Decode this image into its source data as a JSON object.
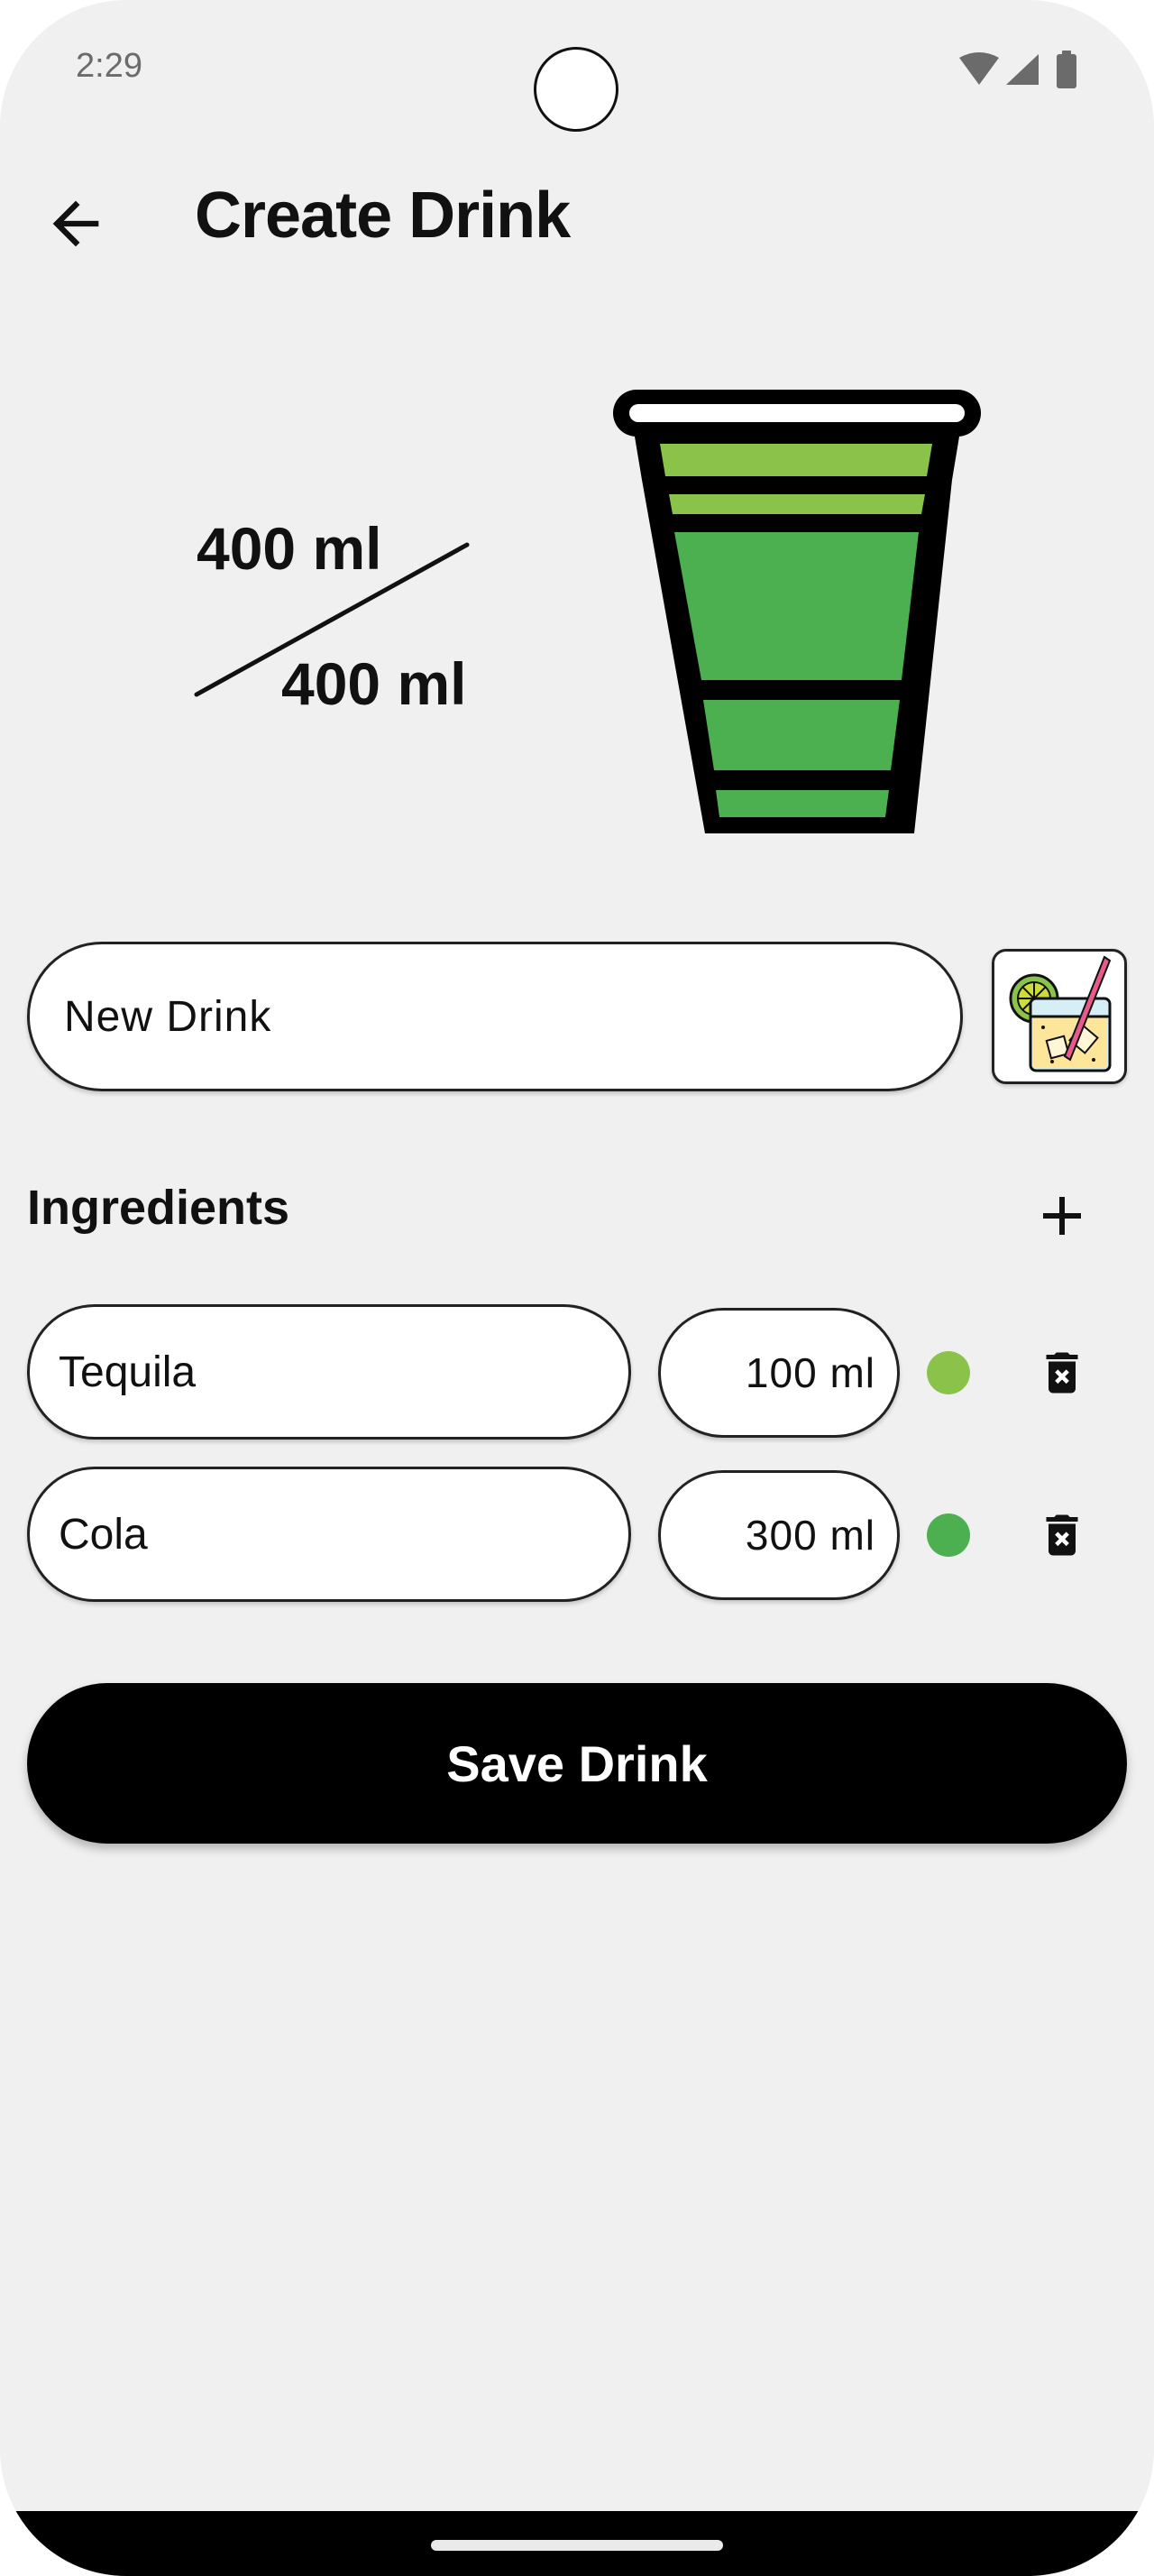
{
  "status_bar": {
    "time": "2:29",
    "icons": [
      "wifi-icon",
      "signal-icon",
      "battery-icon"
    ]
  },
  "app_bar": {
    "back_icon": "arrow-back-icon",
    "title": "Create Drink"
  },
  "volume": {
    "current": "400 ml",
    "total": "400 ml"
  },
  "cup": {
    "layers": [
      {
        "name": "Tequila",
        "color": "#8bc34a",
        "amount_ml": 100
      },
      {
        "name": "Cola",
        "color": "#4caf50",
        "amount_ml": 300
      }
    ],
    "capacity_ml": 400
  },
  "drink_name": {
    "value": "New Drink"
  },
  "drink_icon": {
    "icon": "cocktail-glass-icon"
  },
  "ingredients_section": {
    "title": "Ingredients",
    "add_icon": "plus-icon"
  },
  "ingredients": [
    {
      "name": "Tequila",
      "amount": "100 ml",
      "color": "#8bc34a",
      "delete_icon": "trash-icon"
    },
    {
      "name": "Cola",
      "amount": "300 ml",
      "color": "#4caf50",
      "delete_icon": "trash-icon"
    }
  ],
  "save_button": {
    "label": "Save Drink"
  },
  "colors": {
    "background": "#f0f0f0",
    "accent": "#000000",
    "tequila": "#8bc34a",
    "cola": "#4caf50"
  }
}
